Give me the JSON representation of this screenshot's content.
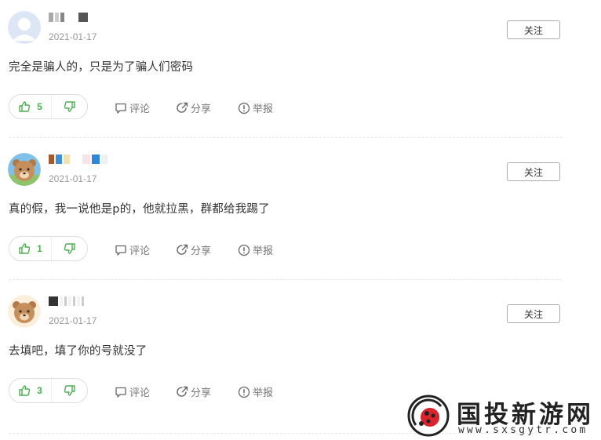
{
  "comments": [
    {
      "date": "2021-01-17",
      "follow_label": "关注",
      "text": "完全是骗人的，只是为了骗人们密码",
      "likes": "5",
      "reply_label": "评论",
      "share_label": "分享",
      "report_label": "举报"
    },
    {
      "date": "2021-01-17",
      "follow_label": "关注",
      "text": "真的假，我一说他是p的，他就拉黑，群都给我踢了",
      "likes": "1",
      "reply_label": "评论",
      "share_label": "分享",
      "report_label": "举报"
    },
    {
      "date": "2021-01-17",
      "follow_label": "关注",
      "text": "去填吧，填了你的号就没了",
      "likes": "3",
      "reply_label": "评论",
      "share_label": "分享",
      "report_label": "举报"
    }
  ],
  "watermark": {
    "title": "国投新游网",
    "url": "www.sxsgytr.com"
  },
  "colors": {
    "like_green": "#4caf50",
    "text": "#333333",
    "muted": "#999999"
  }
}
